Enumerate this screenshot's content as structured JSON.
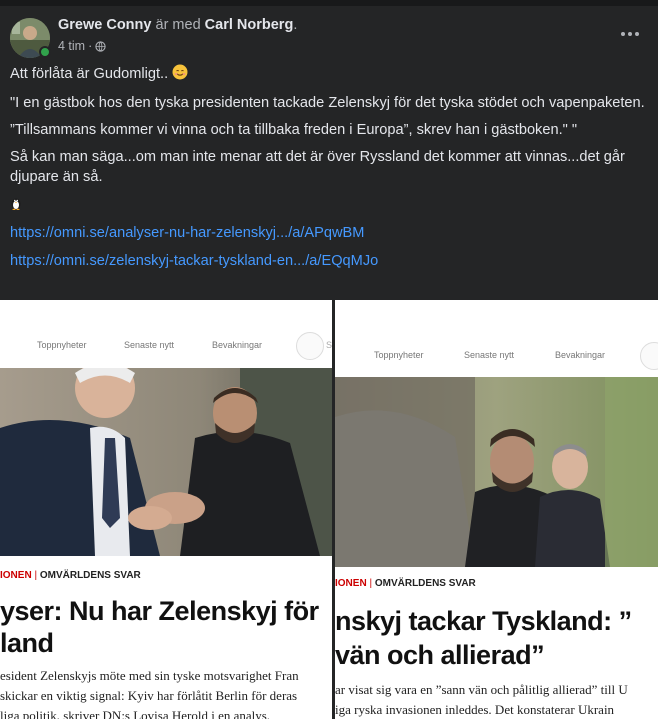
{
  "post": {
    "author": "Grewe Conny",
    "with_text": "är med",
    "tagged": "Carl Norberg",
    "tagged_suffix": ".",
    "time": "4 tim",
    "separator": "·",
    "privacy_icon": "globe-icon",
    "more_icon": "more-options-icon",
    "lines": [
      "Att förlåta är Gudomligt..",
      "\"I en gästbok hos den tyska presidenten tackade Zelenskyj för det tyska stödet och vapenpaketen.",
      "”Tillsammans kommer vi vinna och ta tillbaka freden i Europa”, skrev han i gästboken.\" \"",
      "Så kan man säga...om man inte menar att det är över Ryssland det kommer att vinnas...det går djupare än så."
    ],
    "emoji_1": "smiling-face-icon",
    "emoji_2": "penguin-icon",
    "links": [
      "https://omni.se/analyser-nu-har-zelenskyj.../a/APqwBM",
      "https://omni.se/zelenskyj-tackar-tyskland-en.../a/EQqMJo"
    ]
  },
  "images": {
    "left": {
      "nav": [
        "Toppnyheter",
        "Senaste nytt",
        "Bevakningar"
      ],
      "search_hint": "S",
      "kicker_a": "IONEN",
      "kicker_sep": "|",
      "kicker_b": "OMVÄRLDENS SVAR",
      "headline_1": "yser: Nu har Zelenskyj för",
      "headline_2": "land",
      "lede_1": "esident Zelenskyjs möte med sin tyske motsvarighet Fran",
      "lede_2": "skickar en viktig signal: Kyiv har förlåtit Berlin för deras",
      "lede_3": "liga politik, skriver DN:s Lovisa Herold i en analys."
    },
    "right": {
      "nav": [
        "Toppnyheter",
        "Senaste nytt",
        "Bevakningar"
      ],
      "kicker_a": "IONEN",
      "kicker_sep": "|",
      "kicker_b": "OMVÄRLDENS SVAR",
      "headline_1": "nskyj tackar Tyskland: ”",
      "headline_2": "vän och allierad”",
      "lede_1": "ar visat sig vara en ”sann vän och pålitlig allierad” till U",
      "lede_2": "iga ryska invasionen inleddes. Det konstaterar Ukrain"
    }
  },
  "colors": {
    "background": "#242526",
    "text": "#e4e6eb",
    "muted": "#b0b3b8",
    "link": "#4599ff",
    "online": "#31a24c",
    "kicker_red": "#cc0000"
  }
}
